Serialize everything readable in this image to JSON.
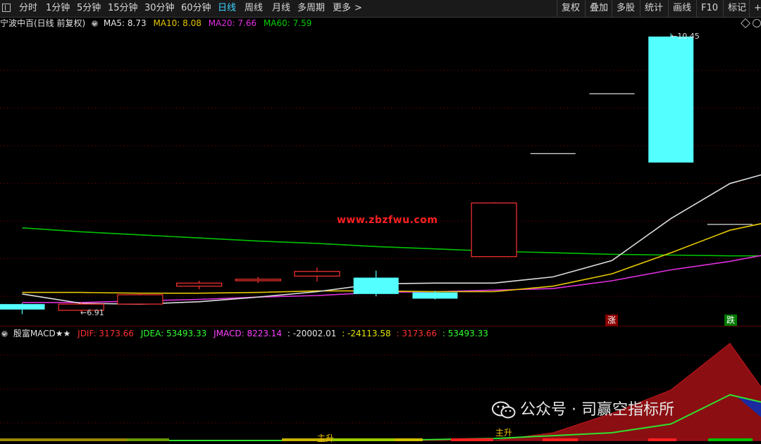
{
  "toolbar": {
    "periods": [
      "分时",
      "1分钟",
      "5分钟",
      "15分钟",
      "30分钟",
      "60分钟",
      "日线",
      "周线",
      "月线",
      "多周期",
      "更多"
    ],
    "active_period": "日线",
    "more_arrow": ">",
    "right_buttons": [
      "复权",
      "叠加",
      "多股",
      "统计",
      "画线",
      "F10",
      "标记",
      "+自"
    ]
  },
  "info": {
    "title": "宁波中百(日线 前复权)",
    "ma5": "MA5: 8.73",
    "ma10": "MA10: 8.08",
    "ma20": "MA20: 7.66",
    "ma60": "MA60: 7.59"
  },
  "chart_labels": {
    "high": "10.45",
    "low": "6.91",
    "url": "www.zbzfwu.com",
    "rise": "涨",
    "fall": "跌",
    "main_rise": "主升"
  },
  "macd": {
    "title": "殷富MACD★★",
    "jdif": "JDIF: 3173.66",
    "jdea": "JDEA: 53493.33",
    "jmacd": "JMACD: 8223.14",
    "v1": ": -20002.01",
    "v2": ": -24113.58",
    "v3": ": 3173.66",
    "v4": ": 53493.33"
  },
  "watermark": {
    "text": "公众号 · 司赢空指标所"
  },
  "colors": {
    "up": "#ff3232",
    "down": "#54ffff",
    "ma5": "#dcdcdc",
    "ma10": "#e6c800",
    "ma20": "#e030e0",
    "ma60": "#00c000",
    "grid": "#8b0000",
    "active": "#3fd0ff"
  },
  "chart_data": {
    "type": "candlestick",
    "candles": [
      {
        "open": 6.97,
        "close": 6.9,
        "high": 6.98,
        "low": 6.84
      },
      {
        "open": 6.89,
        "close": 6.97,
        "high": 6.99,
        "low": 6.87
      },
      {
        "open": 6.97,
        "close": 7.09,
        "high": 7.11,
        "low": 6.97
      },
      {
        "open": 7.2,
        "close": 7.24,
        "high": 7.27,
        "low": 7.16
      },
      {
        "open": 7.27,
        "close": 7.29,
        "high": 7.32,
        "low": 7.24
      },
      {
        "open": 7.33,
        "close": 7.39,
        "high": 7.44,
        "low": 7.26
      },
      {
        "open": 7.31,
        "close": 7.1,
        "high": 7.4,
        "low": 7.07
      },
      {
        "open": 7.12,
        "close": 7.04,
        "high": 7.14,
        "low": 7.03
      },
      {
        "open": 7.58,
        "close": 8.27,
        "high": 8.28,
        "low": 7.58
      },
      {
        "open": 8.91,
        "close": 8.91,
        "high": 8.91,
        "low": 8.91
      },
      {
        "open": 9.68,
        "close": 9.68,
        "high": 9.68,
        "low": 9.68
      },
      {
        "open": 10.41,
        "close": 8.79,
        "high": 10.45,
        "low": 8.79
      },
      {
        "open": 8.0,
        "close": 8.0,
        "high": 8.0,
        "low": 8.0
      }
    ],
    "ma5": [
      7.1,
      6.98,
      6.97,
      7.0,
      7.06,
      7.13,
      7.23,
      7.24,
      7.24,
      7.32,
      7.53,
      8.07,
      8.52,
      8.73
    ],
    "ma10": [
      7.12,
      7.12,
      7.11,
      7.11,
      7.12,
      7.14,
      7.14,
      7.13,
      7.13,
      7.2,
      7.36,
      7.63,
      7.92,
      8.08
    ],
    "ma20": [
      6.99,
      6.99,
      7.01,
      7.03,
      7.06,
      7.08,
      7.12,
      7.13,
      7.15,
      7.17,
      7.27,
      7.41,
      7.52,
      7.66
    ],
    "ma60": [
      7.95,
      7.9,
      7.86,
      7.82,
      7.78,
      7.75,
      7.71,
      7.68,
      7.65,
      7.63,
      7.61,
      7.6,
      7.59,
      7.59
    ],
    "price_range": [
      6.7,
      10.5
    ],
    "macd_area": [
      0,
      0,
      0,
      0,
      0,
      0,
      0,
      0,
      0,
      0.08,
      0.28,
      0.52,
      1.0,
      0.15
    ],
    "macd_line": [
      0,
      0,
      0,
      0,
      0,
      0,
      0,
      0.01,
      0.02,
      0.05,
      0.08,
      0.17,
      0.47,
      0.33
    ]
  }
}
